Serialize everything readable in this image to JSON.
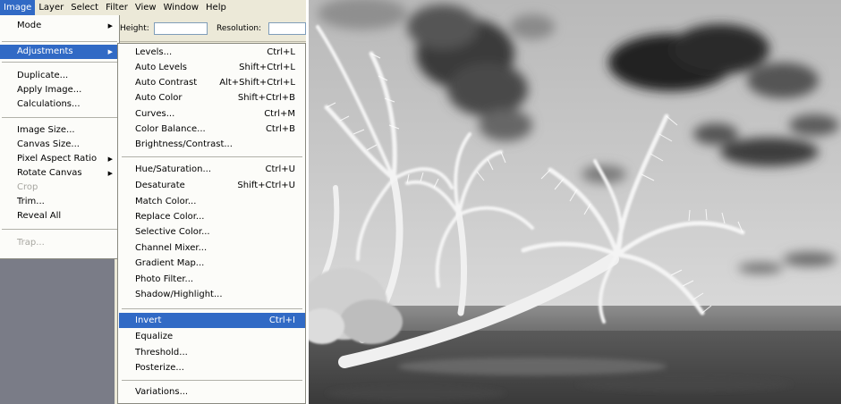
{
  "menubar": {
    "items": [
      "Image",
      "Layer",
      "Select",
      "Filter",
      "View",
      "Window",
      "Help"
    ]
  },
  "options": {
    "height_label": "Height:",
    "resolution_label": "Resolution:"
  },
  "image_menu": {
    "mode": "Mode",
    "adjustments": "Adjustments",
    "duplicate": "Duplicate...",
    "apply_image": "Apply Image...",
    "calculations": "Calculations...",
    "image_size": "Image Size...",
    "canvas_size": "Canvas Size...",
    "pixel_aspect_ratio": "Pixel Aspect Ratio",
    "rotate_canvas": "Rotate Canvas",
    "crop": "Crop",
    "trim": "Trim...",
    "reveal_all": "Reveal All",
    "trap": "Trap..."
  },
  "adjustments_menu": {
    "items": [
      {
        "label": "Levels...",
        "shortcut": "Ctrl+L"
      },
      {
        "label": "Auto Levels",
        "shortcut": "Shift+Ctrl+L"
      },
      {
        "label": "Auto Contrast",
        "shortcut": "Alt+Shift+Ctrl+L"
      },
      {
        "label": "Auto Color",
        "shortcut": "Shift+Ctrl+B"
      },
      {
        "label": "Curves...",
        "shortcut": "Ctrl+M"
      },
      {
        "label": "Color Balance...",
        "shortcut": "Ctrl+B"
      },
      {
        "label": "Brightness/Contrast...",
        "shortcut": ""
      },
      {
        "label": "Hue/Saturation...",
        "shortcut": "Ctrl+U"
      },
      {
        "label": "Desaturate",
        "shortcut": "Shift+Ctrl+U"
      },
      {
        "label": "Match Color...",
        "shortcut": ""
      },
      {
        "label": "Replace Color...",
        "shortcut": ""
      },
      {
        "label": "Selective Color...",
        "shortcut": ""
      },
      {
        "label": "Channel Mixer...",
        "shortcut": ""
      },
      {
        "label": "Gradient Map...",
        "shortcut": ""
      },
      {
        "label": "Photo Filter...",
        "shortcut": ""
      },
      {
        "label": "Shadow/Highlight...",
        "shortcut": ""
      },
      {
        "label": "Invert",
        "shortcut": "Ctrl+I"
      },
      {
        "label": "Equalize",
        "shortcut": ""
      },
      {
        "label": "Threshold...",
        "shortcut": ""
      },
      {
        "label": "Posterize...",
        "shortcut": ""
      },
      {
        "label": "Variations...",
        "shortcut": ""
      }
    ]
  },
  "colors": {
    "highlight": "#316ac5",
    "menu_bg": "#fcfcf9",
    "chrome": "#ece9d8",
    "workspace": "#7a7c87"
  }
}
